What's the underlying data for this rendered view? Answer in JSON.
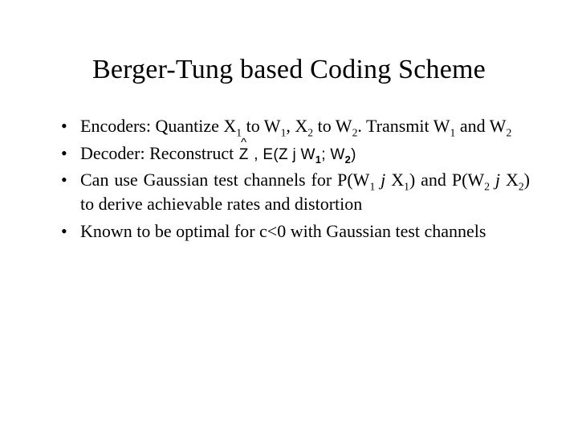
{
  "title": "Berger-Tung based Coding Scheme",
  "bullets": {
    "b1": {
      "pre": "Encoders: Quantize X",
      "s1": "1",
      "t1": " to W",
      "s2": "1",
      "t2": ", X",
      "s3": "2",
      "t3": " to W",
      "s4": "2",
      "t4": ". Transmit W",
      "s5": "1",
      "t5": " and W",
      "s6": "2"
    },
    "b2": {
      "pre": "Decoder: Reconstruct   ",
      "zchar": "Z",
      "comma": " ,   ",
      "expr_head": "E(Z j W",
      "expr_s1": "1",
      "expr_mid": "; W",
      "expr_s2": "2",
      "expr_tail": ")"
    },
    "b3": {
      "pre": "Can use Gaussian test channels for P(W",
      "s1": "1",
      "t1": " ",
      "jglyph1": "j",
      "t1b": " X",
      "s2": "1",
      "t2": ") and P(W",
      "s3": "2",
      "t3": " ",
      "jglyph2": "j",
      "t3b": " X",
      "s4": "2",
      "t4": ") to derive achievable rates and distortion"
    },
    "b4": {
      "text": "Known to be optimal for c<0 with Gaussian test channels"
    }
  }
}
